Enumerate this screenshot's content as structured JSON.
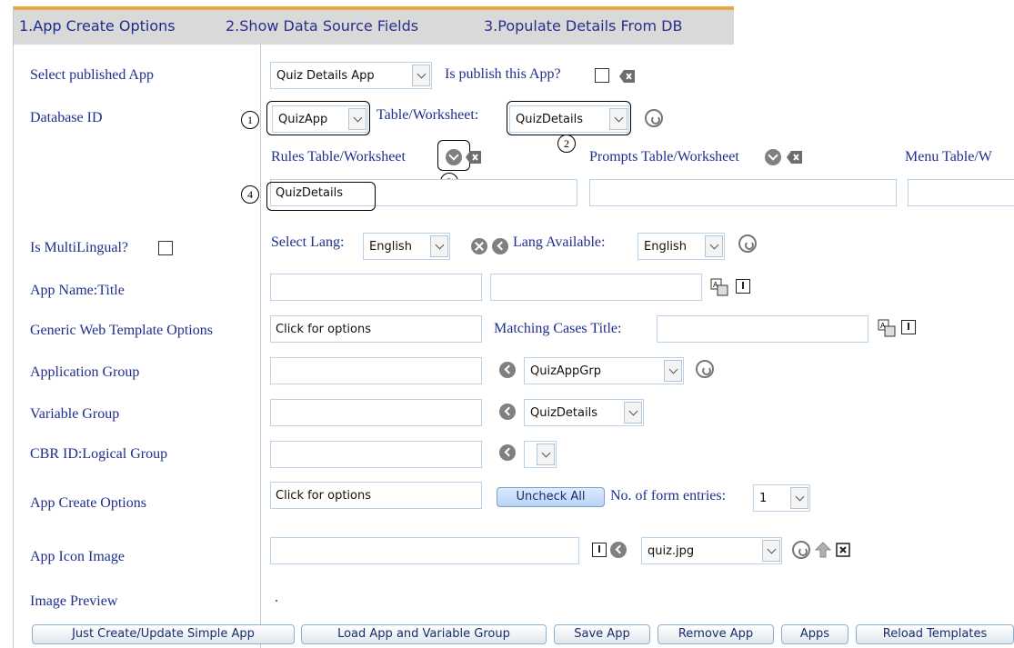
{
  "tabs": [
    {
      "label": "1.App Create Options"
    },
    {
      "label": "2.Show Data Source Fields"
    },
    {
      "label": "3.Populate Details From DB"
    }
  ],
  "labels": {
    "select_published_app": "Select published App",
    "database_id": "Database ID",
    "is_multilingual": "Is MultiLingual?",
    "app_name_title": "App Name:Title",
    "generic_web_template_options": "Generic Web Template Options",
    "application_group": "Application Group",
    "variable_group": "Variable Group",
    "cbr_id_logical_group": "CBR ID:Logical Group",
    "app_create_options": "App Create Options",
    "app_icon_image": "App Icon Image",
    "image_preview": "Image Preview"
  },
  "inline_text": {
    "is_publish_this_app": "Is publish this App?",
    "table_worksheet": "Table/Worksheet:",
    "rules_table_worksheet": "Rules Table/Worksheet",
    "prompts_table_worksheet": "Prompts Table/Worksheet",
    "menu_table_worksheet": "Menu Table/W",
    "select_lang": "Select Lang:",
    "lang_available": "Lang Available:",
    "matching_cases_title": "Matching Cases Title:",
    "no_of_form_entries": "No. of form entries:",
    "image_preview_dot": "."
  },
  "fields": {
    "published_app": "Quiz Details App",
    "database_id": "QuizApp",
    "table_worksheet": "QuizDetails",
    "rules_table": "QuizDetails",
    "prompts_table": "",
    "menu_table": "",
    "select_lang": "English",
    "lang_available": "English",
    "app_name": "",
    "app_title": "",
    "generic_web_template": "Click for options",
    "matching_cases_title": "",
    "application_group_input": "",
    "application_group_select": "QuizAppGrp",
    "variable_group_input": "",
    "variable_group_select": "QuizDetails",
    "cbr_id_input": "",
    "cbr_id_select": "",
    "app_create_options": "Click for options",
    "form_entries": "1",
    "app_icon_input": "",
    "app_icon_select": "quiz.jpg"
  },
  "buttons": {
    "uncheck_all": "Uncheck All",
    "just_create_update": "Just Create/Update Simple App",
    "load_app_variable_group": "Load App and Variable Group",
    "save_app": "Save App",
    "remove_app": "Remove App",
    "apps": "Apps",
    "reload_templates": "Reload Templates"
  },
  "callouts": [
    "1",
    "2",
    "3",
    "4"
  ],
  "colors": {
    "label_blue": "#1f2e8d",
    "tab_bar": "#d9d9d9",
    "tab_accent": "#e9a641",
    "input_border": "#b9d3ea"
  }
}
